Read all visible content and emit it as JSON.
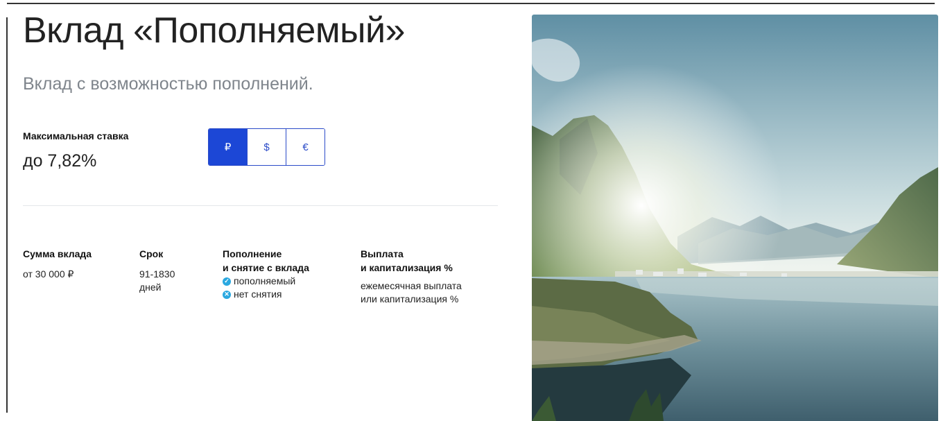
{
  "product": {
    "title": "Вклад «Пополняемый»",
    "subtitle": "Вклад с возможностью пополнений."
  },
  "rate": {
    "label": "Максимальная ставка",
    "value": "до 7,82%"
  },
  "currency": {
    "options": [
      "₽",
      "$",
      "€"
    ],
    "selected": "₽"
  },
  "details": {
    "amount": {
      "heading": "Сумма вклада",
      "value": "от 30 000 ₽"
    },
    "term": {
      "heading": "Срок",
      "value": "91-1830\nдней"
    },
    "deposit": {
      "heading": "Пополнение\nи снятие с вклада",
      "features": [
        {
          "icon": "check-circle-icon",
          "text": "пополняемый"
        },
        {
          "icon": "cross-circle-icon",
          "text": "нет снятия"
        }
      ]
    },
    "payout": {
      "heading": "Выплата\nи капитализация %",
      "value": "ежемесячная выплата\nили капитализация %"
    }
  },
  "colors": {
    "accent": "#1c47d6",
    "feature_icon": "#2aa8e0",
    "subtitle": "#7f858c"
  }
}
